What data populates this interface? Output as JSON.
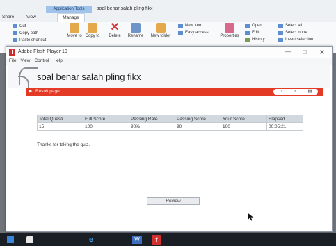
{
  "explorer": {
    "context_tab_group": "Application Tools",
    "window_title": "soal benar salah pling fikx",
    "tabs": [
      "Share",
      "View",
      "Manage"
    ],
    "clipboard": {
      "cut": "Cut",
      "copy_path": "Copy path",
      "paste_shortcut": "Paste shortcut"
    },
    "organize": {
      "move_to": "Move to",
      "copy_to": "Copy to",
      "delete": "Delete",
      "rename": "Rename"
    },
    "new": {
      "new_folder": "New folder",
      "new_item": "New item",
      "easy_access": "Easy access"
    },
    "open": {
      "properties": "Properties",
      "open": "Open",
      "edit": "Edit",
      "history": "History"
    },
    "select": {
      "select_all": "Select all",
      "select_none": "Select none",
      "invert_selection": "Invert selection"
    }
  },
  "flash_window": {
    "title": "Adobe Flash Player 10",
    "menu": [
      "File",
      "View",
      "Control",
      "Help"
    ],
    "controls": {
      "minimize": "—",
      "maximize": "□",
      "close": "✕"
    }
  },
  "quiz": {
    "title": "soal benar salah pling fikx",
    "result_label": "Result page",
    "table": {
      "headers": [
        "Total Questi...",
        "Full Score",
        "Passing Rate",
        "Passing Score",
        "Your Score",
        "Elapsed"
      ],
      "rows": [
        [
          "15",
          "100",
          "90%",
          "90",
          "100",
          "00:05:21"
        ]
      ]
    },
    "thanks_message": "Thanks for taking the quiz.",
    "review_button": "Review",
    "icons": [
      "home-icon",
      "volume-icon",
      "print-icon"
    ]
  },
  "taskbar": {
    "icons": [
      "start-icon",
      "lock-icon",
      "edge-icon",
      "word-icon",
      "flash-icon"
    ],
    "edge_glyph": "e",
    "word_glyph": "W",
    "flash_glyph": "f"
  }
}
